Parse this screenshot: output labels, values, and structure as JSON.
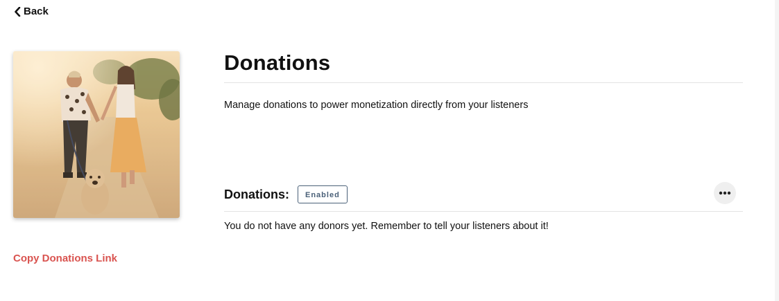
{
  "nav": {
    "back_label": "Back",
    "back_icon": "chevron-left-icon"
  },
  "cover": {
    "image": "couple-walking-dog-photo"
  },
  "sidebar": {
    "copy_link_label": "Copy Donations Link"
  },
  "main": {
    "title": "Donations",
    "description": "Manage donations to power monetization directly from your listeners",
    "section_label": "Donations:",
    "status_badge": "Enabled",
    "more_icon": "ellipsis-icon",
    "empty_message": "You do not have any donors yet. Remember to tell your listeners about it!"
  },
  "colors": {
    "accent": "#d9534f",
    "badge": "#4a6078",
    "text": "#111111"
  }
}
